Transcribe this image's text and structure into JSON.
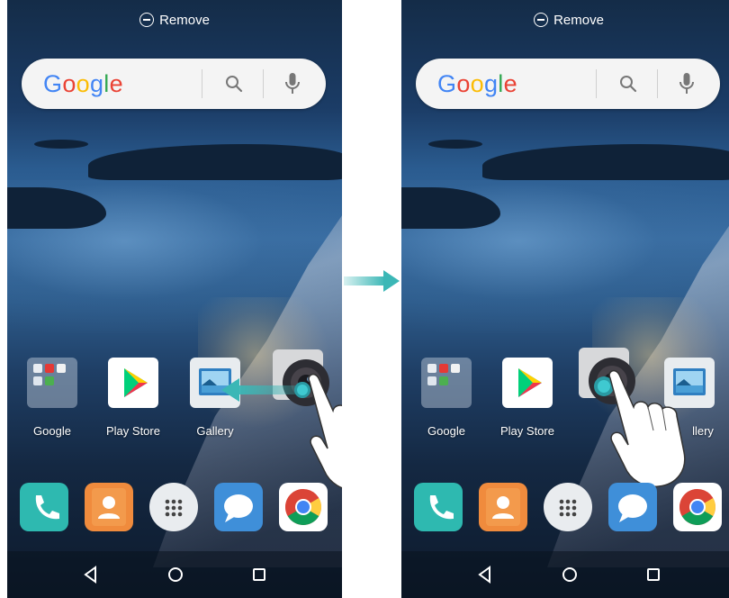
{
  "left_screen": {
    "top_action": {
      "label": "Remove",
      "icon": "remove-circle-icon"
    },
    "search": {
      "logo": "Google",
      "icons": [
        "search-icon",
        "mic-icon"
      ]
    },
    "apps": [
      {
        "label": "Google",
        "icon": "folder-icon"
      },
      {
        "label": "Play Store",
        "icon": "play-store-icon"
      },
      {
        "label": "Gallery",
        "icon": "gallery-icon"
      }
    ],
    "dragged_app": {
      "icon": "camera-icon"
    },
    "dock": [
      "phone-icon",
      "contacts-icon",
      "app-drawer-icon",
      "messages-icon",
      "chrome-icon"
    ],
    "navbar": [
      "back-icon",
      "home-icon",
      "recents-icon"
    ]
  },
  "right_screen": {
    "top_action": {
      "label": "Remove",
      "icon": "remove-circle-icon"
    },
    "search": {
      "logo": "Google",
      "icons": [
        "search-icon",
        "mic-icon"
      ]
    },
    "apps": [
      {
        "label": "Google",
        "icon": "folder-icon"
      },
      {
        "label": "Play Store",
        "icon": "play-store-icon"
      },
      {
        "label": "Gallery",
        "icon": "gallery-icon",
        "label_visible": "llery"
      }
    ],
    "dragged_app": {
      "icon": "camera-icon"
    },
    "dock": [
      "phone-icon",
      "contacts-icon",
      "app-drawer-icon",
      "messages-icon",
      "chrome-icon"
    ],
    "navbar": [
      "back-icon",
      "home-icon",
      "recents-icon"
    ]
  },
  "transition_arrow": {
    "icon": "arrow-right-icon",
    "color": "#3bb7b6"
  },
  "colors": {
    "accent_teal": "#3bb7b6",
    "google_blue": "#4285f4",
    "google_red": "#ea4335",
    "google_yellow": "#fbbc05",
    "google_green": "#34a853"
  }
}
